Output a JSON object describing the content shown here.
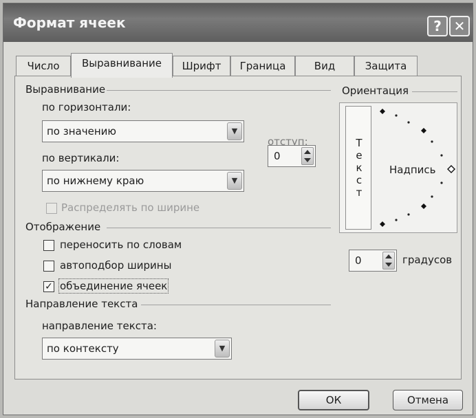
{
  "window": {
    "title": "Формат ячеек",
    "help_glyph": "?",
    "close_glyph": "✕"
  },
  "tabs": [
    {
      "label": "Число"
    },
    {
      "label": "Выравнивание",
      "active": true
    },
    {
      "label": "Шрифт"
    },
    {
      "label": "Граница"
    },
    {
      "label": "Вид"
    },
    {
      "label": "Защита"
    }
  ],
  "alignment": {
    "group_title": "Выравнивание",
    "horizontal_label": "по горизонтали:",
    "horizontal_value": "по значению",
    "vertical_label": "по вертикали:",
    "vertical_value": "по нижнему краю",
    "indent_label": "отступ:",
    "indent_value": "0",
    "distribute_label": "Распределять по ширине",
    "distribute_checked": false,
    "distribute_enabled": false
  },
  "display": {
    "group_title": "Отображение",
    "wrap_text_label": "переносить по словам",
    "wrap_text_checked": false,
    "shrink_to_fit_label": "автоподбор ширины",
    "shrink_to_fit_checked": false,
    "merge_cells_label": "объединение ячеек",
    "merge_cells_checked": true,
    "check_glyph": "✓"
  },
  "text_direction": {
    "group_title": "Направление текста",
    "label": "направление текста:",
    "value": "по контексту"
  },
  "orientation": {
    "group_title": "Ориентация",
    "vertical_text": [
      "Т",
      "е",
      "к",
      "с",
      "т"
    ],
    "dial_label": "Надпись",
    "degrees_value": "0",
    "degrees_label": "градусов"
  },
  "buttons": {
    "ok": "ОК",
    "cancel": "Отмена"
  },
  "dropdown_arrow": "▼"
}
